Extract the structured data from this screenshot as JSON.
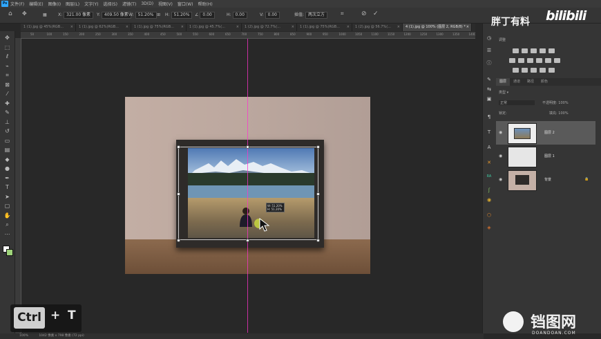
{
  "menu": {
    "items": [
      "文件(F)",
      "编辑(E)",
      "图像(I)",
      "图层(L)",
      "文字(Y)",
      "选择(S)",
      "滤镜(T)",
      "3D(D)",
      "视图(V)",
      "窗口(W)",
      "帮助(H)"
    ]
  },
  "options": {
    "x_label": "X:",
    "x_value": "321.00 像素",
    "y_label": "Y:",
    "y_value": "409.50 像素",
    "w_label": "W:",
    "w_value": "51.20%",
    "h_label": "H:",
    "h_value": "51.20%",
    "angle_value": "0.00",
    "h_skew_label": "H:",
    "h_skew_value": "0.00",
    "v_skew_label": "V:",
    "v_skew_value": "0.00",
    "interp_label": "插值:",
    "interp_value": "两次立方"
  },
  "tabs": [
    {
      "label": "1 (1).jpg @ 45%(RGB...",
      "active": false
    },
    {
      "label": "1 (1).jpg @ 62%(RGB...",
      "active": false
    },
    {
      "label": "1 (1).jpg @ 75%(RGB...",
      "active": false
    },
    {
      "label": "1 (1).jpg @ 45.7%(...",
      "active": false
    },
    {
      "label": "1 (2).jpg @ 72.7%(...",
      "active": false
    },
    {
      "label": "1 (1).jpg @ 75%(RGB...",
      "active": false
    },
    {
      "label": "1 (2).jpg @ 56.7%(...",
      "active": false
    },
    {
      "label": "4 (1).jpg @ 100% (图层 2, RGB/8) *",
      "active": true
    }
  ],
  "ruler_ticks": [
    "50",
    "100",
    "150",
    "200",
    "250",
    "300",
    "350",
    "400",
    "450",
    "500",
    "550",
    "600",
    "650",
    "700",
    "750",
    "800",
    "850",
    "900",
    "950",
    "1000",
    "1050",
    "1100",
    "1150",
    "1200",
    "1250",
    "1300",
    "1350",
    "1400"
  ],
  "toolbar_icons": [
    "move-icon",
    "marquee-icon",
    "lasso-icon",
    "quick-select-icon",
    "crop-icon",
    "frame-icon",
    "eyedropper-icon",
    "healing-icon",
    "brush-icon",
    "stamp-icon",
    "history-brush-icon",
    "eraser-icon",
    "gradient-icon",
    "blur-icon",
    "dodge-icon",
    "pen-icon",
    "type-icon",
    "path-select-icon",
    "shape-icon",
    "hand-icon",
    "zoom-icon",
    "more-icon"
  ],
  "key_overlay": {
    "ctrl": "Ctrl",
    "plus": "+",
    "t": "T"
  },
  "hud": {
    "line1": "W: 51.20%",
    "line2": "H: 51.20%"
  },
  "status": {
    "zoom": "100%",
    "doc_info": "1042 像素 x 798 像素 (72 ppi)"
  },
  "branding": {
    "channel": "胖丁有料",
    "bili": "bilibili"
  },
  "layers_panel": {
    "tabs": [
      "图层",
      "通道",
      "路径",
      "颜色"
    ],
    "kind_label": "类型",
    "blend_mode": "正常",
    "opacity_label": "不透明度:",
    "opacity_value": "100%",
    "lock_label": "锁定:",
    "fill_label": "填充:",
    "fill_value": "100%",
    "layers": [
      {
        "name": "图层 2",
        "selected": true
      },
      {
        "name": "图层 1",
        "selected": false
      },
      {
        "name": "背景",
        "selected": false
      }
    ]
  },
  "adjustments": {
    "title": "调整"
  },
  "watermark": {
    "cn": "铛图网",
    "en": "DOANDOAN.COM"
  },
  "colors": {
    "guide": "#ff33cc",
    "accent": "#31a8ff",
    "selected_layer": "#5a5a5a"
  }
}
